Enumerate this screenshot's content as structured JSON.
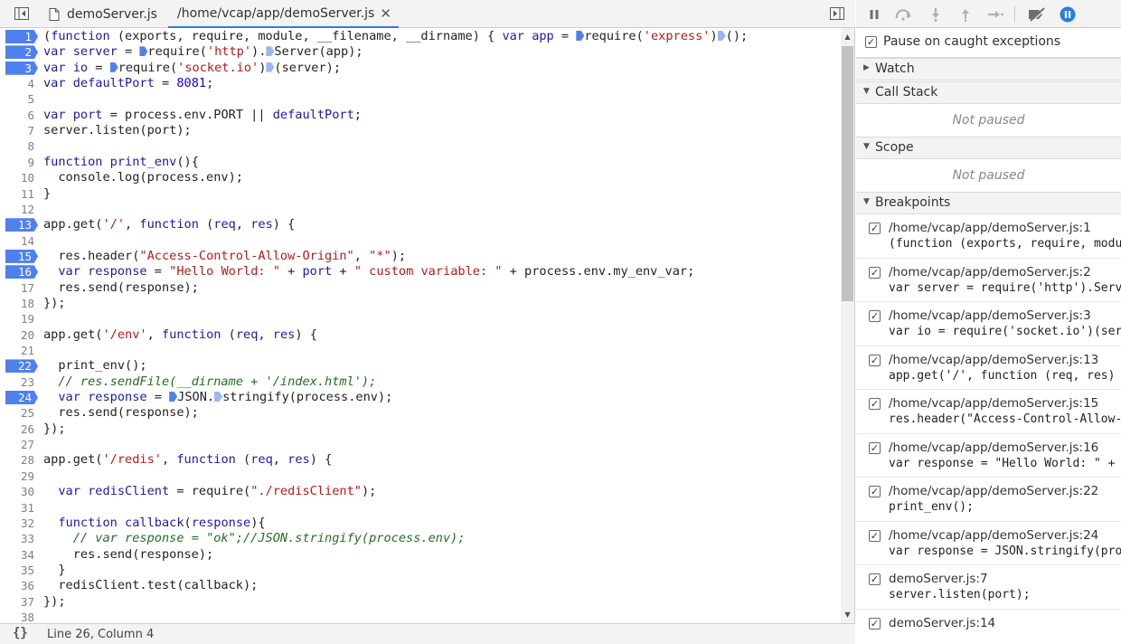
{
  "tabs": [
    {
      "label": "demoServer.js",
      "active": false
    },
    {
      "label": "/home/vcap/app/demoServer.js",
      "active": true
    }
  ],
  "editor": {
    "lines": [
      {
        "n": "1",
        "bp": true,
        "html": "(<span class=\"k\">function</span> (exports, require, module, __filename, __dirname) { <span class=\"k\">var</span> <span class=\"k\">app</span> = <span class=\"m\"></span>require(<span class=\"s\">'express'</span>)<span class=\"m light\"></span>();"
      },
      {
        "n": "2",
        "bp": true,
        "html": "<span class=\"k\">var</span> <span class=\"k\">server</span> = <span class=\"m\"></span>require(<span class=\"s\">'http'</span>).<span class=\"m light\"></span>Server(app);"
      },
      {
        "n": "3",
        "bp": true,
        "html": "<span class=\"k\">var</span> <span class=\"k\">io</span> = <span class=\"m\"></span>require(<span class=\"s\">'socket.io'</span>)<span class=\"m light\"></span>(server);"
      },
      {
        "n": "4",
        "bp": false,
        "html": "<span class=\"k\">var</span> <span class=\"k\">defaultPort</span> = <span class=\"n\">8081</span>;"
      },
      {
        "n": "5",
        "bp": false,
        "html": ""
      },
      {
        "n": "6",
        "bp": false,
        "html": "<span class=\"k\">var</span> <span class=\"k\">port</span> = process.env.PORT || <span class=\"k\">defaultPort</span>;"
      },
      {
        "n": "7",
        "bp": false,
        "html": "server.listen(port);"
      },
      {
        "n": "8",
        "bp": false,
        "html": ""
      },
      {
        "n": "9",
        "bp": false,
        "html": "<span class=\"k\">function</span> <span class=\"k\">print_env</span>(){"
      },
      {
        "n": "10",
        "bp": false,
        "html": "  console.log(process.env);"
      },
      {
        "n": "11",
        "bp": false,
        "html": "}"
      },
      {
        "n": "12",
        "bp": false,
        "html": ""
      },
      {
        "n": "13",
        "bp": true,
        "html": "app.get(<span class=\"s\">'/'</span>, <span class=\"k\">function</span> (<span class=\"k\">req</span>, <span class=\"k\">res</span>) {"
      },
      {
        "n": "14",
        "bp": false,
        "html": ""
      },
      {
        "n": "15",
        "bp": true,
        "html": "  res.header(<span class=\"s\">\"Access-Control-Allow-Origin\"</span>, <span class=\"s\">\"*\"</span>);"
      },
      {
        "n": "16",
        "bp": true,
        "html": "  <span class=\"k\">var</span> <span class=\"k\">response</span> = <span class=\"s\">\"Hello World: \"</span> + <span class=\"k\">port</span> + <span class=\"s\">\" custom variable: \"</span> + process.env.my_env_var;"
      },
      {
        "n": "17",
        "bp": false,
        "html": "  res.send(response);"
      },
      {
        "n": "18",
        "bp": false,
        "html": "});"
      },
      {
        "n": "19",
        "bp": false,
        "html": ""
      },
      {
        "n": "20",
        "bp": false,
        "html": "app.get(<span class=\"s\">'/env'</span>, <span class=\"k\">function</span> (<span class=\"k\">req</span>, <span class=\"k\">res</span>) {"
      },
      {
        "n": "21",
        "bp": false,
        "html": ""
      },
      {
        "n": "22",
        "bp": true,
        "html": "  print_env();"
      },
      {
        "n": "23",
        "bp": false,
        "html": "  <span class=\"c\">// res.sendFile(__dirname + '/index.html');</span>"
      },
      {
        "n": "24",
        "bp": true,
        "html": "  <span class=\"k\">var</span> <span class=\"k\">response</span> = <span class=\"m\"></span>JSON.<span class=\"m light\"></span>stringify(process.env);"
      },
      {
        "n": "25",
        "bp": false,
        "html": "  res.send(response);"
      },
      {
        "n": "26",
        "bp": false,
        "html": "});"
      },
      {
        "n": "27",
        "bp": false,
        "html": ""
      },
      {
        "n": "28",
        "bp": false,
        "html": "app.get(<span class=\"s\">'/redis'</span>, <span class=\"k\">function</span> (<span class=\"k\">req</span>, <span class=\"k\">res</span>) {"
      },
      {
        "n": "29",
        "bp": false,
        "html": ""
      },
      {
        "n": "30",
        "bp": false,
        "html": "  <span class=\"k\">var</span> <span class=\"k\">redisClient</span> = require(<span class=\"s\">\"./redisClient\"</span>);"
      },
      {
        "n": "31",
        "bp": false,
        "html": ""
      },
      {
        "n": "32",
        "bp": false,
        "html": "  <span class=\"k\">function</span> <span class=\"k\">callback</span>(<span class=\"k\">response</span>){"
      },
      {
        "n": "33",
        "bp": false,
        "html": "    <span class=\"c\">// var response = \"ok\";//JSON.stringify(process.env);</span>"
      },
      {
        "n": "34",
        "bp": false,
        "html": "    res.send(response);"
      },
      {
        "n": "35",
        "bp": false,
        "html": "  }"
      },
      {
        "n": "36",
        "bp": false,
        "html": "  redisClient.test(callback);"
      },
      {
        "n": "37",
        "bp": false,
        "html": "});"
      },
      {
        "n": "38",
        "bp": false,
        "html": ""
      }
    ]
  },
  "status": {
    "format_symbol": "{}",
    "cursor_position": "Line 26, Column 4"
  },
  "debugger": {
    "pause_on_caught_label": "Pause on caught exceptions",
    "pause_on_caught_checked": true,
    "watch_label": "Watch",
    "call_stack_label": "Call Stack",
    "call_stack_placeholder": "Not paused",
    "scope_label": "Scope",
    "scope_placeholder": "Not paused",
    "breakpoints_label": "Breakpoints",
    "breakpoints": [
      {
        "file": "/home/vcap/app/demoServer.js:1",
        "code": "(function (exports, require, module, __filename, __dirname) {"
      },
      {
        "file": "/home/vcap/app/demoServer.js:2",
        "code": "var server = require('http').Server(app);"
      },
      {
        "file": "/home/vcap/app/demoServer.js:3",
        "code": "var io = require('socket.io')(server);"
      },
      {
        "file": "/home/vcap/app/demoServer.js:13",
        "code": "app.get('/', function (req, res) {"
      },
      {
        "file": "/home/vcap/app/demoServer.js:15",
        "code": "res.header(\"Access-Control-Allow-Origin\", \"*\");"
      },
      {
        "file": "/home/vcap/app/demoServer.js:16",
        "code": "var response = \"Hello World: \" + port"
      },
      {
        "file": "/home/vcap/app/demoServer.js:22",
        "code": "print_env();"
      },
      {
        "file": "/home/vcap/app/demoServer.js:24",
        "code": "var response = JSON.stringify(process.env);"
      },
      {
        "file": "demoServer.js:7",
        "code": "server.listen(port);"
      },
      {
        "file": "demoServer.js:14",
        "code": ""
      }
    ]
  },
  "colors": {
    "breakpoint": "#4f80ef",
    "accent_tab": "#3879d9",
    "keyword": "#1c1aa3",
    "string": "#b21b1b",
    "comment": "#236e25",
    "pause_button": "#2a7de1"
  }
}
